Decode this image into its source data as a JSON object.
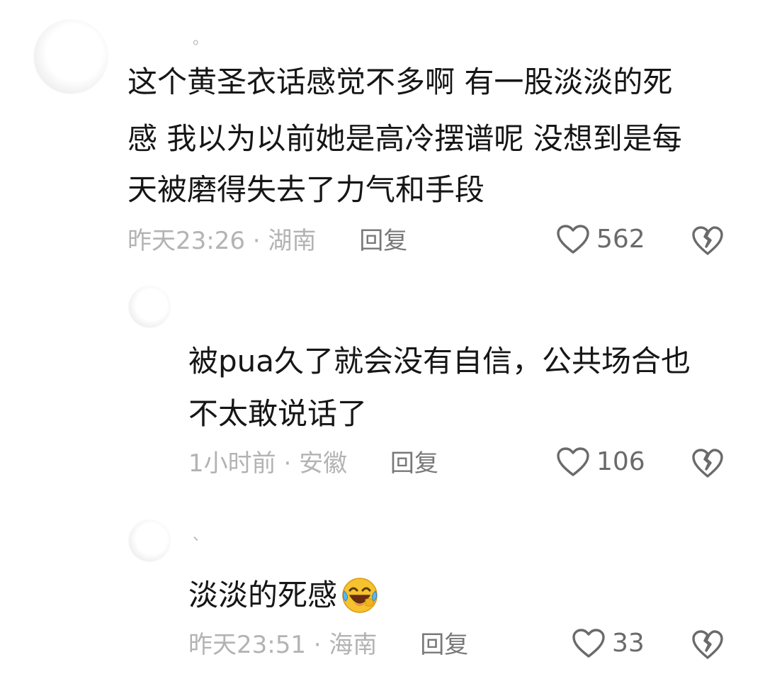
{
  "comments": [
    {
      "nickname": "。",
      "text_lines": [
        "这个黄圣衣话感觉不多啊 有一股淡淡的死",
        "感 我以为以前她是高冷摆谱呢 没想到是每",
        "天被磨得失去了力气和手段"
      ],
      "time": "昨天23:26",
      "separator": " · ",
      "location": "湖南",
      "reply_label": "回复",
      "like_count": "562",
      "icons": {
        "like": "heart-outline-icon",
        "dislike": "broken-heart-icon"
      }
    },
    {
      "nickname": "",
      "text_lines": [
        "被pua久了就会没有自信，公共场合也",
        "不太敢说话了"
      ],
      "time": "1小时前",
      "separator": " · ",
      "location": "安徽",
      "reply_label": "回复",
      "like_count": "106"
    },
    {
      "nickname": "、",
      "text": "淡淡的死感",
      "emoji": "laughing-crying-emoji",
      "time": "昨天23:51",
      "separator": " · ",
      "location": "海南",
      "reply_label": "回复",
      "like_count": "33"
    }
  ],
  "colors": {
    "text": "#161616",
    "meta": "#b3b3b3",
    "reply": "#787878",
    "icon": "#6a6a6a",
    "emoji_face": "#f6c22e"
  }
}
